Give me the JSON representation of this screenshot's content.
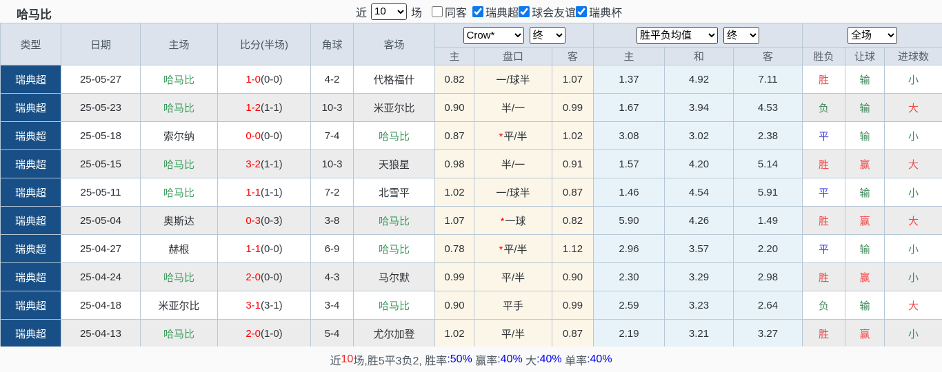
{
  "page": {
    "title": "哈马比"
  },
  "topbar": {
    "near_label": "近",
    "matches_select": "10",
    "matches_unit_label": "场",
    "checkboxes": [
      {
        "label": "同客",
        "checked": false
      },
      {
        "label": "瑞典超",
        "checked": true
      },
      {
        "label": "球会友谊",
        "checked": true
      },
      {
        "label": "瑞典杯",
        "checked": true
      }
    ]
  },
  "table": {
    "columns": [
      "类型",
      "日期",
      "主场",
      "比分(半场)",
      "角球",
      "客场"
    ],
    "odds_group": {
      "bookmaker_select": "Crow*",
      "time_select": "终",
      "sub": [
        "主",
        "盘口",
        "客"
      ]
    },
    "europe_group": {
      "type_select": "胜平负均值",
      "time_select": "终",
      "sub": [
        "主",
        "和",
        "客"
      ]
    },
    "result_group": {
      "scope_select": "全场",
      "sub": [
        "胜负",
        "让球",
        "进球数"
      ]
    },
    "rows": [
      {
        "type": "瑞典超",
        "date": "25-05-27",
        "home": "哈马比",
        "score": "1-0",
        "half": "(0-0)",
        "corners": "4-2",
        "away": "代格福什",
        "odds_home": "0.82",
        "handicap": "一/球半",
        "star": false,
        "odds_away": "1.07",
        "eu_home": "1.37",
        "eu_draw": "4.92",
        "eu_away": "7.11",
        "result": "胜",
        "handicap_result": "输",
        "goals_result": "小"
      },
      {
        "type": "瑞典超",
        "date": "25-05-23",
        "home": "哈马比",
        "score": "1-2",
        "half": "(1-1)",
        "corners": "10-3",
        "away": "米亚尔比",
        "odds_home": "0.90",
        "handicap": "半/一",
        "star": false,
        "odds_away": "0.99",
        "eu_home": "1.67",
        "eu_draw": "3.94",
        "eu_away": "4.53",
        "result": "负",
        "handicap_result": "输",
        "goals_result": "大"
      },
      {
        "type": "瑞典超",
        "date": "25-05-18",
        "home": "索尔纳",
        "score": "0-0",
        "half": "(0-0)",
        "corners": "7-4",
        "away": "哈马比",
        "odds_home": "0.87",
        "handicap": "平/半",
        "star": true,
        "odds_away": "1.02",
        "eu_home": "3.08",
        "eu_draw": "3.02",
        "eu_away": "2.38",
        "result": "平",
        "handicap_result": "输",
        "goals_result": "小"
      },
      {
        "type": "瑞典超",
        "date": "25-05-15",
        "home": "哈马比",
        "score": "3-2",
        "half": "(1-1)",
        "corners": "10-3",
        "away": "天狼星",
        "odds_home": "0.98",
        "handicap": "半/一",
        "star": false,
        "odds_away": "0.91",
        "eu_home": "1.57",
        "eu_draw": "4.20",
        "eu_away": "5.14",
        "result": "胜",
        "handicap_result": "赢",
        "goals_result": "大"
      },
      {
        "type": "瑞典超",
        "date": "25-05-11",
        "home": "哈马比",
        "score": "1-1",
        "half": "(1-1)",
        "corners": "7-2",
        "away": "北雪平",
        "odds_home": "1.02",
        "handicap": "一/球半",
        "star": false,
        "odds_away": "0.87",
        "eu_home": "1.46",
        "eu_draw": "4.54",
        "eu_away": "5.91",
        "result": "平",
        "handicap_result": "输",
        "goals_result": "小"
      },
      {
        "type": "瑞典超",
        "date": "25-05-04",
        "home": "奥斯达",
        "score": "0-3",
        "half": "(0-3)",
        "corners": "3-8",
        "away": "哈马比",
        "odds_home": "1.07",
        "handicap": "一球",
        "star": true,
        "odds_away": "0.82",
        "eu_home": "5.90",
        "eu_draw": "4.26",
        "eu_away": "1.49",
        "result": "胜",
        "handicap_result": "赢",
        "goals_result": "大"
      },
      {
        "type": "瑞典超",
        "date": "25-04-27",
        "home": "赫根",
        "score": "1-1",
        "half": "(0-0)",
        "corners": "6-9",
        "away": "哈马比",
        "odds_home": "0.78",
        "handicap": "平/半",
        "star": true,
        "odds_away": "1.12",
        "eu_home": "2.96",
        "eu_draw": "3.57",
        "eu_away": "2.20",
        "result": "平",
        "handicap_result": "输",
        "goals_result": "小"
      },
      {
        "type": "瑞典超",
        "date": "25-04-24",
        "home": "哈马比",
        "score": "2-0",
        "half": "(0-0)",
        "corners": "4-3",
        "away": "马尔默",
        "odds_home": "0.99",
        "handicap": "平/半",
        "star": false,
        "odds_away": "0.90",
        "eu_home": "2.30",
        "eu_draw": "3.29",
        "eu_away": "2.98",
        "result": "胜",
        "handicap_result": "赢",
        "goals_result": "小"
      },
      {
        "type": "瑞典超",
        "date": "25-04-18",
        "home": "米亚尔比",
        "score": "3-1",
        "half": "(3-1)",
        "corners": "3-4",
        "away": "哈马比",
        "odds_home": "0.90",
        "handicap": "平手",
        "star": false,
        "odds_away": "0.99",
        "eu_home": "2.59",
        "eu_draw": "3.23",
        "eu_away": "2.64",
        "result": "负",
        "handicap_result": "输",
        "goals_result": "大"
      },
      {
        "type": "瑞典超",
        "date": "25-04-13",
        "home": "哈马比",
        "score": "2-0",
        "half": "(1-0)",
        "corners": "5-4",
        "away": "尤尔加登",
        "odds_home": "1.02",
        "handicap": "平/半",
        "star": false,
        "odds_away": "0.87",
        "eu_home": "2.19",
        "eu_draw": "3.21",
        "eu_away": "3.27",
        "result": "胜",
        "handicap_result": "赢",
        "goals_result": "小"
      }
    ]
  },
  "footer": {
    "segments": [
      {
        "text": "近",
        "color": "dark"
      },
      {
        "text": "10",
        "color": "red"
      },
      {
        "text": "场,胜5平3负2, ",
        "color": "dark"
      },
      {
        "text": "胜率",
        "color": "dark"
      },
      {
        "text": ":50%",
        "color": "blue"
      },
      {
        "text": " 赢率",
        "color": "dark"
      },
      {
        "text": ":40%",
        "color": "blue"
      },
      {
        "text": " 大",
        "color": "dark"
      },
      {
        "text": ":40%",
        "color": "blue"
      },
      {
        "text": " 单率",
        "color": "dark"
      },
      {
        "text": ":40%",
        "color": "blue"
      }
    ]
  },
  "colors": {
    "type_cell_bg": "#184f86",
    "header_bg": "#dce3ec",
    "cream_col_bg": "#fbf6e8",
    "blue_col_bg": "#e8f3f9",
    "stripe_bg": "#ececec",
    "team_highlight_green": "#3a9b5c",
    "score_red": "#fd0000",
    "result_red": "#f34a4a",
    "result_blue": "#4747e8",
    "result_green": "#3e8a5a",
    "checkbox_accent": "#0b79f0"
  }
}
